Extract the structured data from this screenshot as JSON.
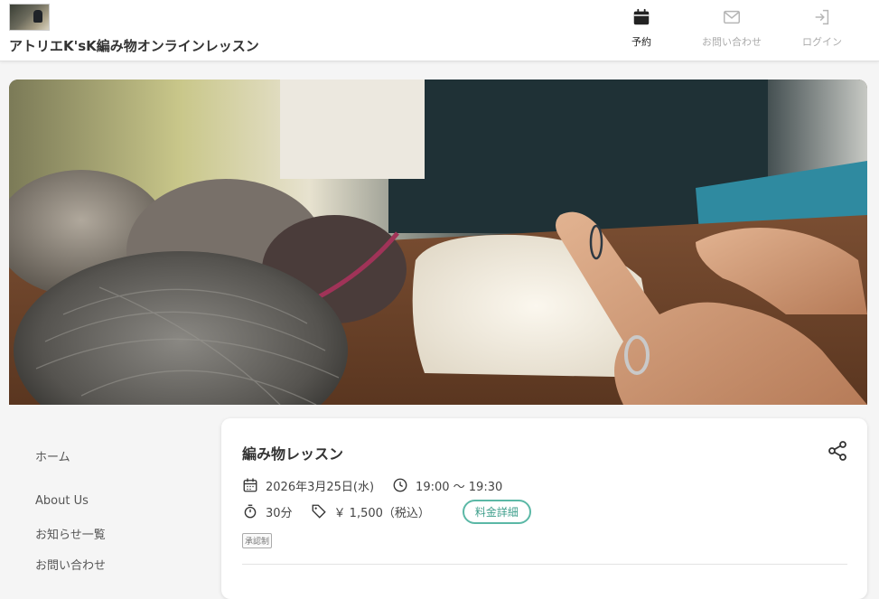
{
  "header": {
    "site_title": "アトリエK'sK編み物オンラインレッスン",
    "nav": {
      "reserve": "予約",
      "contact": "お問い合わせ",
      "login": "ログイン"
    }
  },
  "sidebar": {
    "items": [
      "ホーム",
      "About Us",
      "お知らせ一覧",
      "お問い合わせ"
    ]
  },
  "lesson": {
    "title": "編み物レッスン",
    "date": "2026年3月25日(水)",
    "time": "19:00 〜 19:30",
    "duration": "30分",
    "price": "￥ 1,500（税込）",
    "price_detail_label": "料金詳細",
    "approval_badge": "承認制"
  },
  "colors": {
    "accent": "#5bb8a6",
    "header_bg": "#ffffff",
    "page_bg": "#f5f5f5"
  },
  "icons": {
    "reserve": "calendar-icon",
    "contact": "mail-icon",
    "login": "login-icon",
    "date": "calendar-icon",
    "time": "clock-icon",
    "duration": "stopwatch-icon",
    "price": "tag-icon",
    "share": "share-icon"
  }
}
